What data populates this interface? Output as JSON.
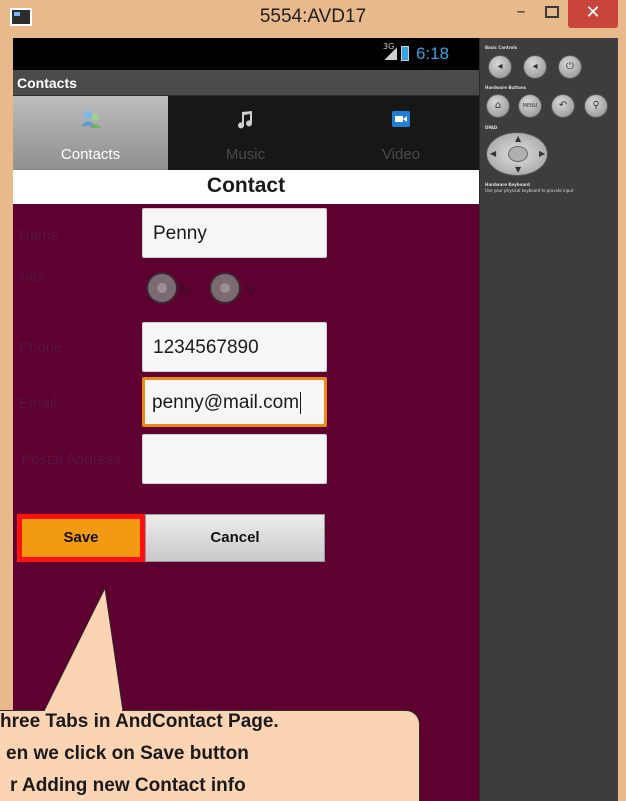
{
  "window": {
    "title": "5554:AVD17",
    "minimize": "–",
    "close": "✕"
  },
  "status_bar": {
    "network": "3G",
    "time": "6:18"
  },
  "action_bar": {
    "title": "Contacts"
  },
  "tabs": [
    {
      "label": "Contacts",
      "icon": "contacts-icon",
      "selected": true
    },
    {
      "label": "Music",
      "icon": "music-note-icon",
      "selected": false
    },
    {
      "label": "Video",
      "icon": "video-camera-icon",
      "selected": false
    }
  ],
  "form": {
    "header": "Contact",
    "name": {
      "label": "Name",
      "value": "Penny"
    },
    "sex": {
      "label": "Sex",
      "options": [
        "M",
        "F"
      ]
    },
    "phone": {
      "label": "Phone",
      "value": "1234567890"
    },
    "email": {
      "label": "Email",
      "value": "penny@mail.com"
    },
    "postal": {
      "label": "Postal Address",
      "value": ""
    },
    "save_label": "Save",
    "cancel_label": "Cancel"
  },
  "panel": {
    "basic_controls": "Basic Controls",
    "hardware_buttons": "Hardware Buttons",
    "menu_label": "MENU",
    "dpad": "DPAD",
    "keyboard_title": "Hardware Keyboard",
    "keyboard_hint": "Use your physical keyboard to provide input"
  },
  "callout": {
    "line1": "hree Tabs in AndContact Page.",
    "line2": "en we click on Save button",
    "line3": "r Adding new Contact info"
  },
  "colors": {
    "screen_bg": "#5e0030",
    "save_bg": "#f29a12",
    "highlight": "#ff1010",
    "focus": "#e98a16",
    "time": "#36a4e0"
  }
}
